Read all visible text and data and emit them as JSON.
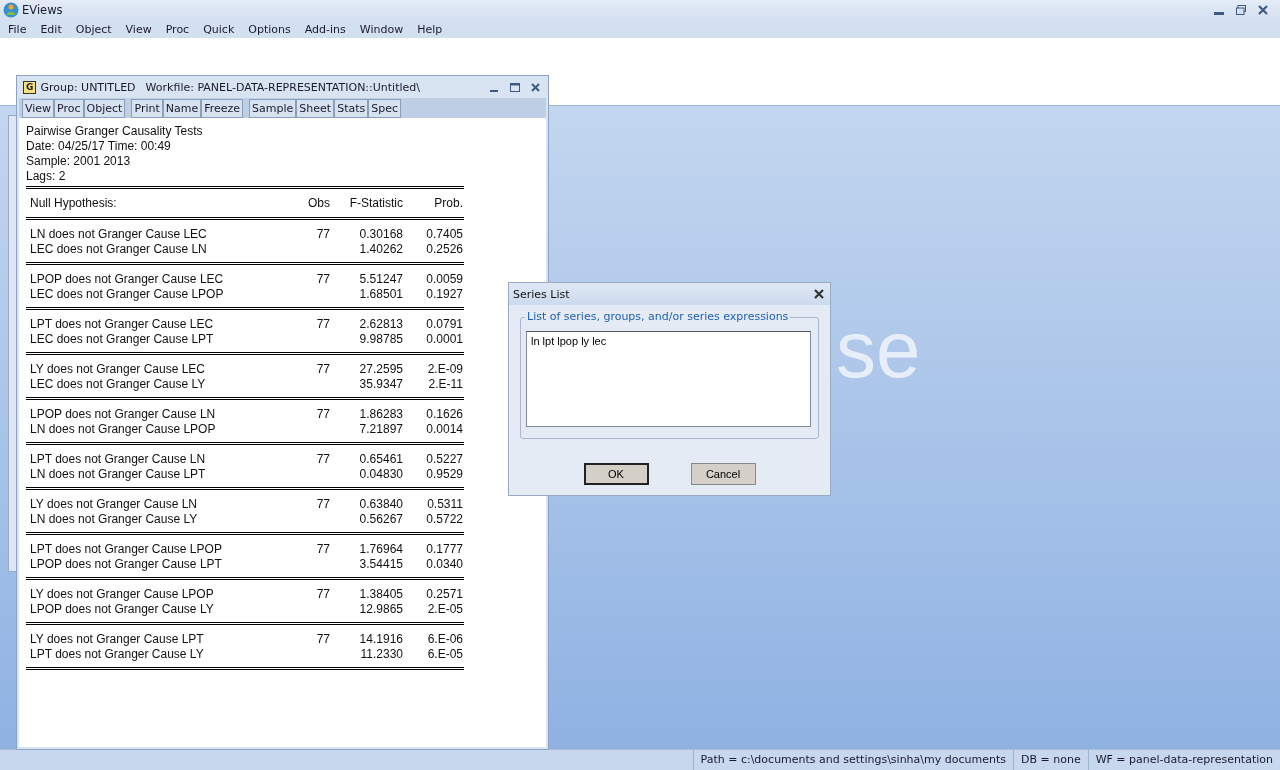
{
  "app": {
    "title": "EViews",
    "menu": [
      "File",
      "Edit",
      "Object",
      "View",
      "Proc",
      "Quick",
      "Options",
      "Add-ins",
      "Window",
      "Help"
    ]
  },
  "background_text": "se",
  "group_window": {
    "badge": "G",
    "title": "Group: UNTITLED",
    "workfile": "Workfile: PANEL-DATA-REPRESENTATION::Untitled\\",
    "toolbar": [
      [
        "View",
        "Proc",
        "Object"
      ],
      [
        "Print",
        "Name",
        "Freeze"
      ],
      [
        "Sample",
        "Sheet",
        "Stats",
        "Spec"
      ]
    ],
    "header": [
      "Pairwise Granger Causality Tests",
      "Date: 04/25/17   Time: 00:49",
      "Sample: 2001 2013",
      "Lags: 2"
    ],
    "columns": [
      "Null Hypothesis:",
      "Obs",
      "F-Statistic",
      "Prob."
    ],
    "tests": [
      {
        "rows": [
          {
            "hypothesis": "LN does not Granger Cause LEC",
            "obs": "77",
            "f": "0.30168",
            "prob": "0.7405"
          },
          {
            "hypothesis": "LEC does not Granger Cause LN",
            "f": "1.40262",
            "prob": "0.2526"
          }
        ]
      },
      {
        "rows": [
          {
            "hypothesis": "LPOP does not Granger Cause LEC",
            "obs": "77",
            "f": "5.51247",
            "prob": "0.0059"
          },
          {
            "hypothesis": "LEC does not Granger Cause LPOP",
            "f": "1.68501",
            "prob": "0.1927"
          }
        ]
      },
      {
        "rows": [
          {
            "hypothesis": "LPT does not Granger Cause LEC",
            "obs": "77",
            "f": "2.62813",
            "prob": "0.0791"
          },
          {
            "hypothesis": "LEC does not Granger Cause LPT",
            "f": "9.98785",
            "prob": "0.0001"
          }
        ]
      },
      {
        "rows": [
          {
            "hypothesis": "LY does not Granger Cause LEC",
            "obs": "77",
            "f": "27.2595",
            "prob": "2.E-09"
          },
          {
            "hypothesis": "LEC does not Granger Cause LY",
            "f": "35.9347",
            "prob": "2.E-11"
          }
        ]
      },
      {
        "rows": [
          {
            "hypothesis": "LPOP does not Granger Cause LN",
            "obs": "77",
            "f": "1.86283",
            "prob": "0.1626"
          },
          {
            "hypothesis": "LN does not Granger Cause LPOP",
            "f": "7.21897",
            "prob": "0.0014"
          }
        ]
      },
      {
        "rows": [
          {
            "hypothesis": "LPT does not Granger Cause LN",
            "obs": "77",
            "f": "0.65461",
            "prob": "0.5227"
          },
          {
            "hypothesis": "LN does not Granger Cause LPT",
            "f": "0.04830",
            "prob": "0.9529"
          }
        ]
      },
      {
        "rows": [
          {
            "hypothesis": "LY does not Granger Cause LN",
            "obs": "77",
            "f": "0.63840",
            "prob": "0.5311"
          },
          {
            "hypothesis": "LN does not Granger Cause LY",
            "f": "0.56267",
            "prob": "0.5722"
          }
        ]
      },
      {
        "rows": [
          {
            "hypothesis": "LPT does not Granger Cause LPOP",
            "obs": "77",
            "f": "1.76964",
            "prob": "0.1777"
          },
          {
            "hypothesis": "LPOP does not Granger Cause LPT",
            "f": "3.54415",
            "prob": "0.0340"
          }
        ]
      },
      {
        "rows": [
          {
            "hypothesis": "LY does not Granger Cause LPOP",
            "obs": "77",
            "f": "1.38405",
            "prob": "0.2571"
          },
          {
            "hypothesis": "LPOP does not Granger Cause LY",
            "f": "12.9865",
            "prob": "2.E-05"
          }
        ]
      },
      {
        "rows": [
          {
            "hypothesis": "LY does not Granger Cause LPT",
            "obs": "77",
            "f": "14.1916",
            "prob": "6.E-06"
          },
          {
            "hypothesis": "LPT does not Granger Cause LY",
            "f": "11.2330",
            "prob": "6.E-05"
          }
        ]
      }
    ]
  },
  "dialog": {
    "title": "Series List",
    "group_label": "List of series, groups, and/or series expressions",
    "value": "ln lpt lpop ly lec",
    "buttons": [
      {
        "label": "OK",
        "default": true
      },
      {
        "label": "Cancel",
        "default": false
      }
    ]
  },
  "status_bar": [
    "Path = c:\\documents and settings\\sinha\\my documents",
    "DB = none",
    "WF = panel-data-representation"
  ]
}
